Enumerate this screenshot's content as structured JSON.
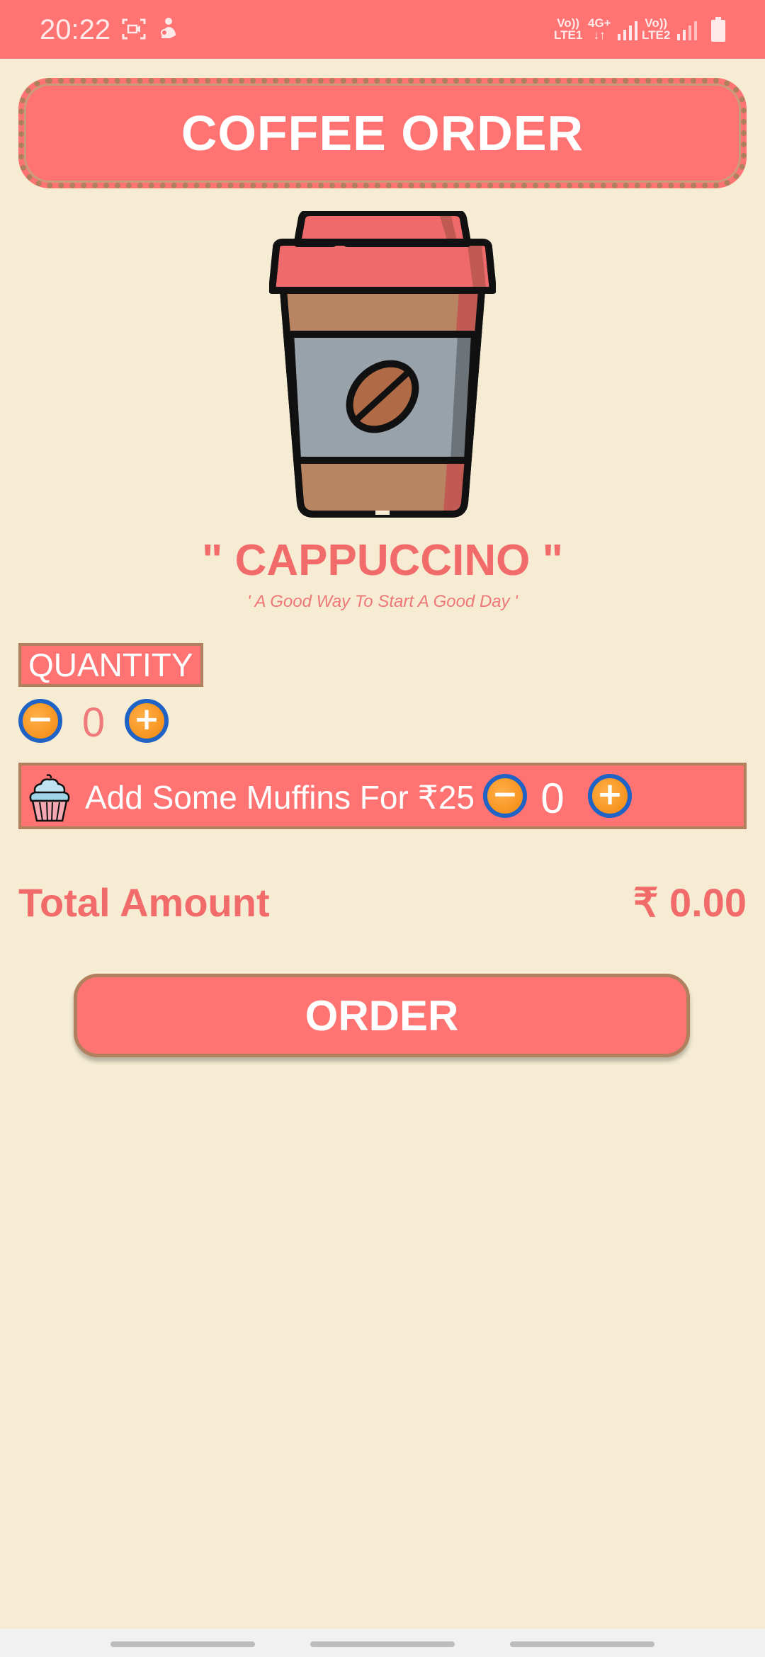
{
  "status_bar": {
    "time": "20:22",
    "sim1": {
      "top": "Vo))",
      "bottom": "LTE1"
    },
    "network_type": {
      "top": "4G+",
      "bottom": "↓↑"
    },
    "sim2": {
      "top": "Vo))",
      "bottom": "LTE2"
    },
    "icons": [
      "screen-record-icon",
      "notification-figure-icon",
      "signal-1-icon",
      "signal-2-icon",
      "battery-icon"
    ]
  },
  "header": {
    "title": "COFFEE ORDER"
  },
  "product": {
    "image": "coffee-cup-icon",
    "name": "\" CAPPUCCINO \"",
    "tagline": "' A Good Way To Start A Good Day '"
  },
  "quantity": {
    "label": "QUANTITY",
    "value": "0",
    "decrement_symbol": "−",
    "increment_symbol": "+"
  },
  "muffins": {
    "icon": "cupcake-icon",
    "label": "Add Some Muffins For ₹25",
    "value": "0",
    "decrement_symbol": "−",
    "increment_symbol": "+"
  },
  "total": {
    "label": "Total Amount",
    "value": "₹ 0.00"
  },
  "order_button": {
    "label": "ORDER"
  },
  "colors": {
    "primary": "#ff7373",
    "background": "#f5ecd3",
    "border_brown": "#b07f5e",
    "button_orange": "#f7931e",
    "button_ring_blue": "#1e63c5"
  }
}
